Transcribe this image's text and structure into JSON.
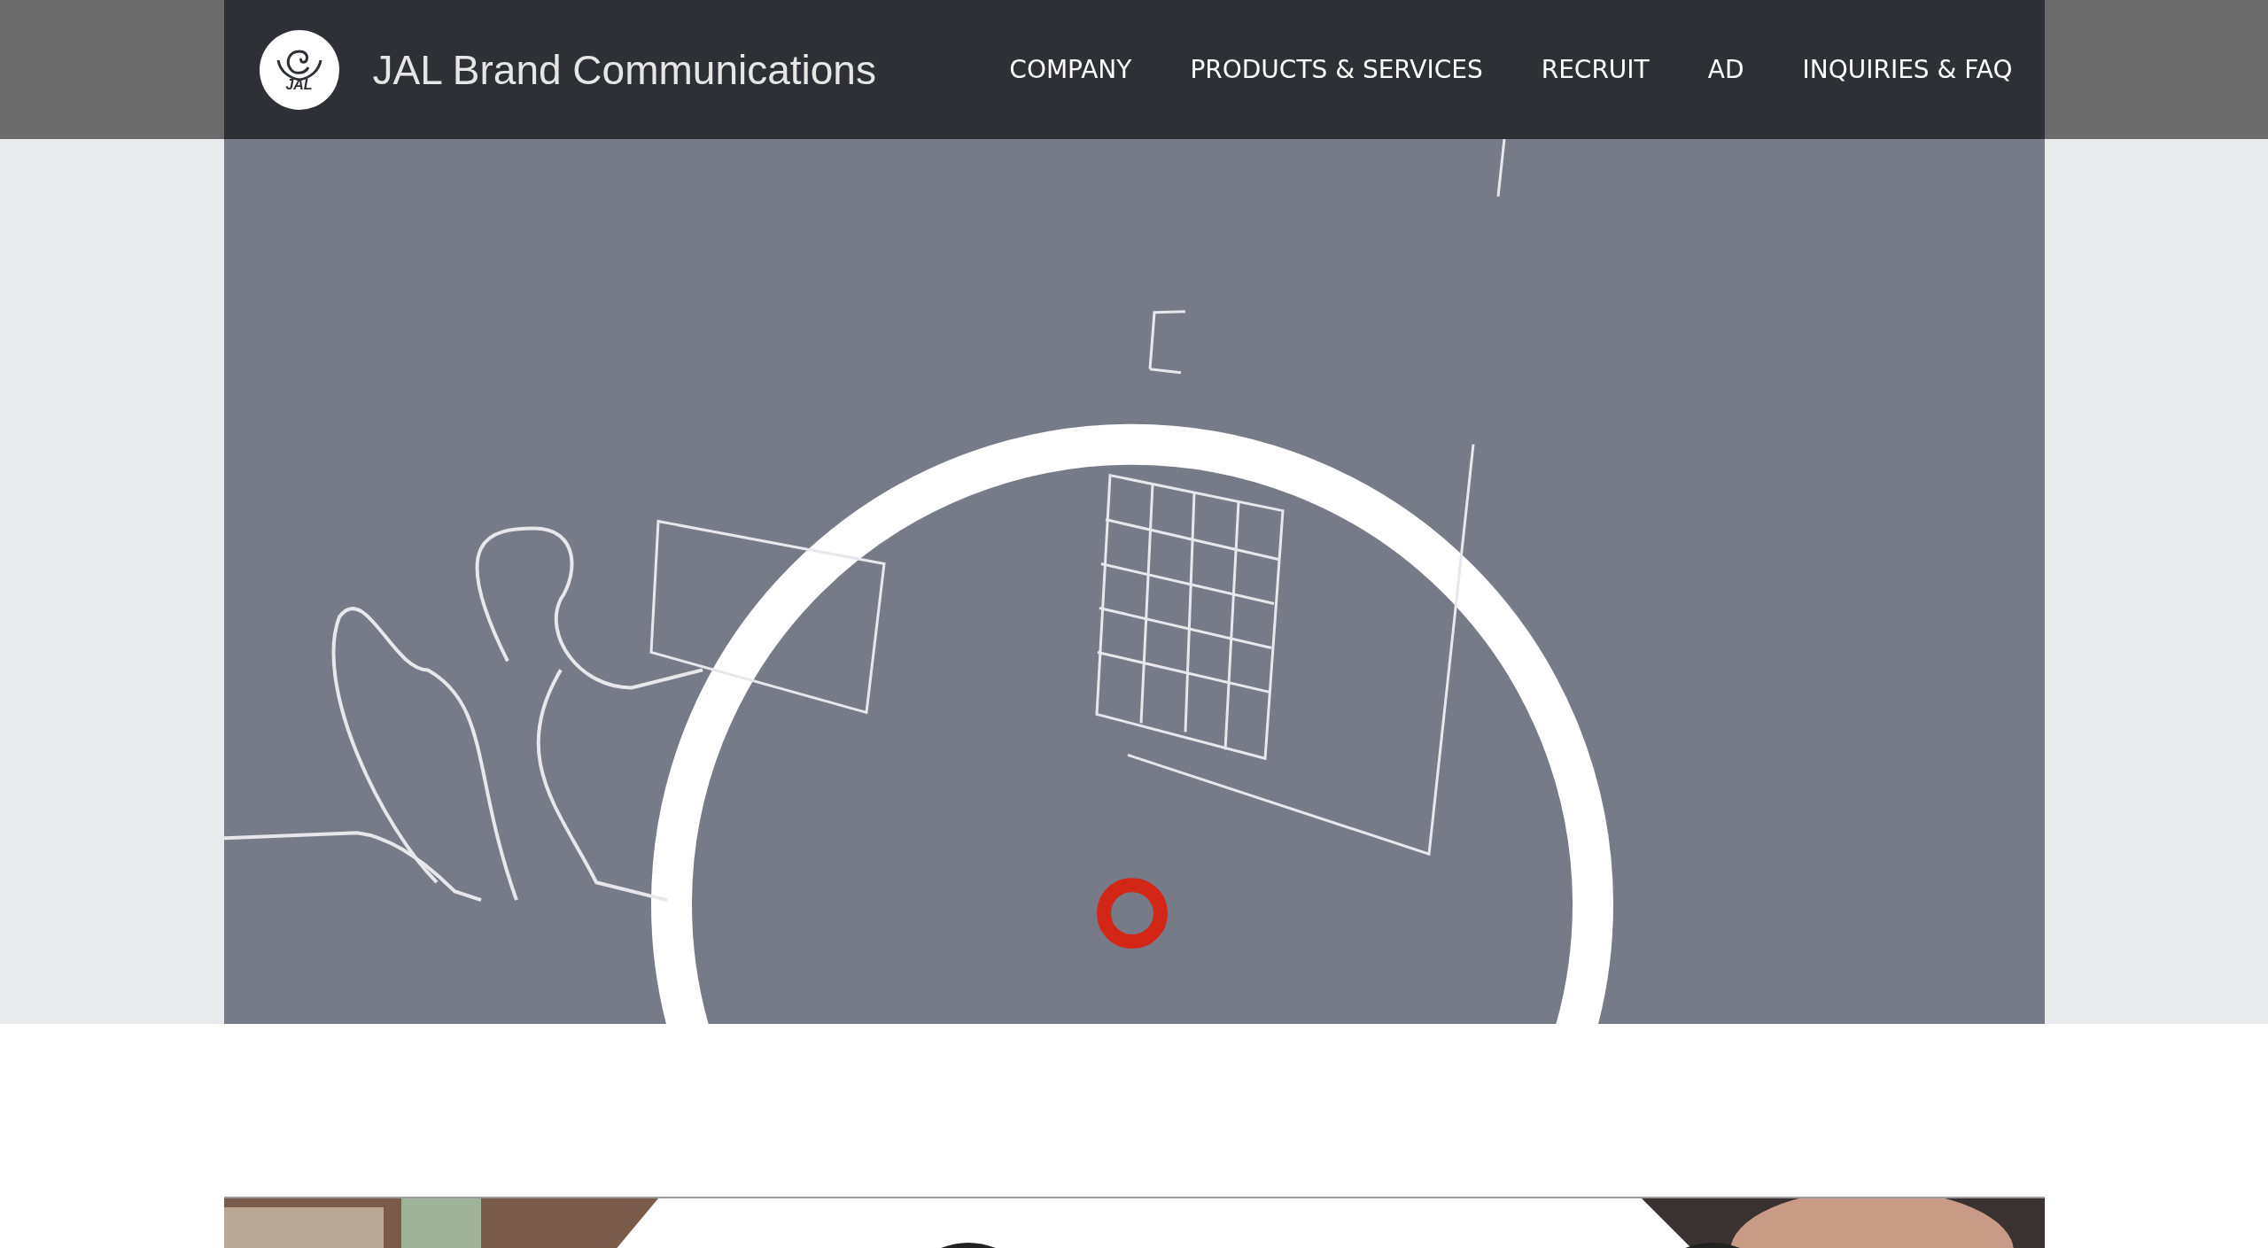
{
  "header": {
    "logo_text": "JAL",
    "title": "JAL Brand Communications"
  },
  "nav": [
    {
      "label": "COMPANY"
    },
    {
      "label": "PRODUCTS & SERVICES"
    },
    {
      "label": "RECRUIT"
    },
    {
      "label": "AD"
    },
    {
      "label": "INQUIRIES & FAQ"
    }
  ]
}
